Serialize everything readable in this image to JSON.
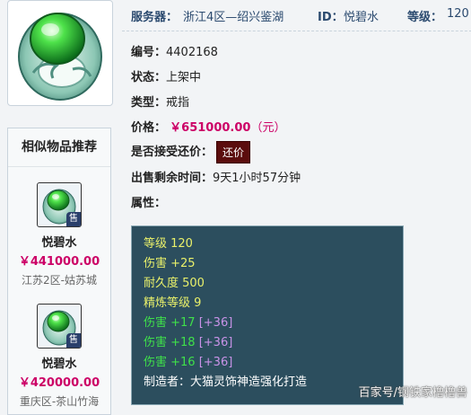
{
  "header": {
    "server_label": "服务器：",
    "server_value": "浙江4区—绍兴鉴湖",
    "id_label": "ID：",
    "id_value": "悦碧水",
    "level_label": "等级：",
    "level_value": "120"
  },
  "details": {
    "number_label": "编号：",
    "number_value": "4402168",
    "status_label": "状态：",
    "status_value": "上架中",
    "type_label": "类型：",
    "type_value": "戒指",
    "price_label": "价格：",
    "price_value": "￥651000.00",
    "price_unit": "（元）",
    "counter_label": "是否接受还价：",
    "counter_badge": "还价",
    "time_label": "出售剩余时间：",
    "time_value": "9天1小时57分钟",
    "attr_label": "属性："
  },
  "attributes": {
    "level": "等级 120",
    "damage": "伤害 +25",
    "durability": "耐久度 500",
    "refine": "精炼等级 9",
    "gems": [
      {
        "stat": "伤害 +17",
        "bonus": "[+36]"
      },
      {
        "stat": "伤害 +18",
        "bonus": "[+36]"
      },
      {
        "stat": "伤害 +16",
        "bonus": "[+36]"
      }
    ],
    "maker": "制造者：大猫灵饰神造强化打造"
  },
  "similar": {
    "title": "相似物品推荐",
    "sale_tag": "售",
    "items": [
      {
        "name": "悦碧水",
        "price": "￥441000.00",
        "server": "江苏2区-姑苏城"
      },
      {
        "name": "悦碧水",
        "price": "￥420000.00",
        "server": "重庆区-茶山竹海"
      }
    ]
  },
  "colors": {
    "price": "#cc0066",
    "panel_bg": "#2c4e5e",
    "attr_yellow": "#e9f06a",
    "attr_green": "#3fe04a",
    "attr_purple": "#c993e8"
  },
  "icons": {
    "item_image": "jade-ring-icon",
    "similar_thumb": "jade-ring-thumbnail-icon"
  },
  "watermark": "百家号/钢铁家橹橹兽"
}
